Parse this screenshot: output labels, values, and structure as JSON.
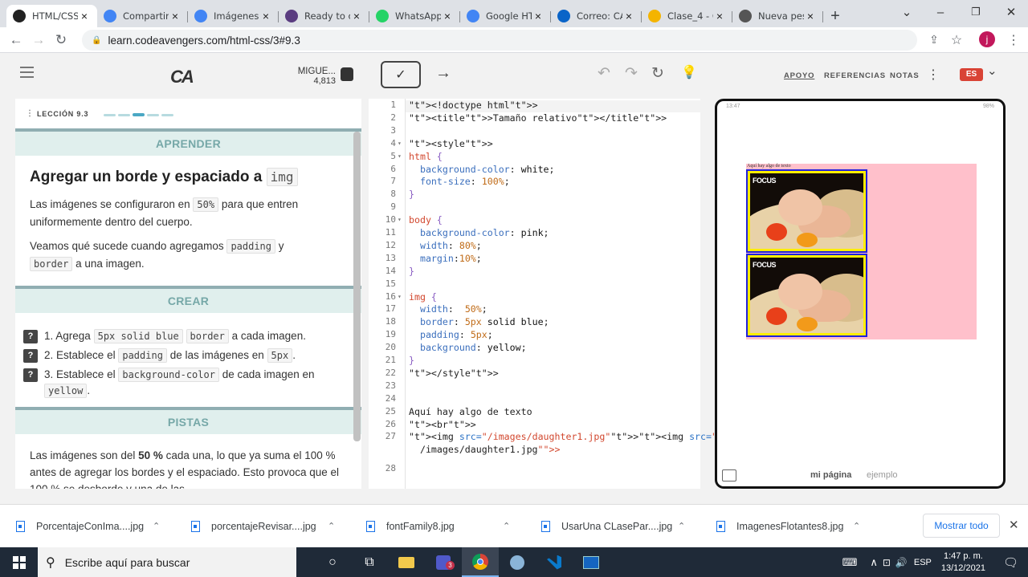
{
  "browser": {
    "tabs": [
      {
        "title": "HTML/CSS",
        "icon": "codeavengers-icon",
        "color": "#222222",
        "active": true
      },
      {
        "title": "Compartir",
        "icon": "google-icon",
        "color": "#4285f4"
      },
      {
        "title": "Imágenes",
        "icon": "google-icon",
        "color": "#4285f4"
      },
      {
        "title": "Ready to c",
        "icon": "ready-icon",
        "color": "#5a3c80"
      },
      {
        "title": "WhatsApp",
        "icon": "whatsapp-icon",
        "color": "#25d366"
      },
      {
        "title": "Google HT",
        "icon": "google-icon",
        "color": "#4285f4"
      },
      {
        "title": "Correo: CA",
        "icon": "outlook-icon",
        "color": "#0a64c8"
      },
      {
        "title": "Clase_4 - C",
        "icon": "drive-icon",
        "color": "#f4b400"
      },
      {
        "title": "Nueva pes",
        "icon": "chrome-icon",
        "color": "#555555"
      }
    ],
    "url": "learn.codeavengers.com/html-css/3#9.3",
    "profile_initial": "j"
  },
  "app": {
    "logo": "CA",
    "user_name": "MIGUE...",
    "user_points": "4,813",
    "header_links": [
      "APOYO",
      "REFERENCIAS",
      "NOTAS"
    ],
    "language": "ES"
  },
  "lesson": {
    "label": "LECCIÓN 9.3",
    "learn_header": "APRENDER",
    "title_text": "Agregar un borde y espaciado a",
    "title_code": "img",
    "p1_a": "Las imágenes se configuraron en",
    "p1_code": "50%",
    "p1_b": "para que entren uniformemente dentro del cuerpo.",
    "p2_a": "Veamos qué sucede cuando agregamos",
    "p2_code1": "padding",
    "p2_b": "y",
    "p2_code2": "border",
    "p2_c": "a una imagen.",
    "create_header": "CREAR",
    "tasks": [
      {
        "num": "1.",
        "a": "Agrega",
        "code1": "5px solid blue",
        "code2": "border",
        "b": "a cada imagen."
      },
      {
        "num": "2.",
        "a": "Establece el",
        "code1": "padding",
        "b": "de las imágenes en",
        "code2": "5px",
        "c": "."
      },
      {
        "num": "3.",
        "a": "Establece el",
        "code1": "background-color",
        "b": "de cada imagen en",
        "code2": "yellow",
        "c": "."
      }
    ],
    "hints_header": "PISTAS",
    "hint_a": "Las imágenes son del",
    "hint_bold": "50 %",
    "hint_b": "cada una, lo que ya suma el 100 % antes de agregar los bordes y el espaciado. Esto",
    "hint_c": "provoca que el 100 % se desborde y una de las"
  },
  "editor": {
    "lines": [
      {
        "n": "1",
        "code": "<!doctype html>"
      },
      {
        "n": "2",
        "code": "<title>Tamaño relativo</title>"
      },
      {
        "n": "3",
        "code": ""
      },
      {
        "n": "4",
        "code": "<style>",
        "fold": true
      },
      {
        "n": "5",
        "code": "html {",
        "fold": true
      },
      {
        "n": "6",
        "code": "  background-color: white;"
      },
      {
        "n": "7",
        "code": "  font-size: 100%;"
      },
      {
        "n": "8",
        "code": "}"
      },
      {
        "n": "9",
        "code": ""
      },
      {
        "n": "10",
        "code": "body {",
        "fold": true
      },
      {
        "n": "11",
        "code": "  background-color: pink;"
      },
      {
        "n": "12",
        "code": "  width: 80%;"
      },
      {
        "n": "13",
        "code": "  margin:10%;"
      },
      {
        "n": "14",
        "code": "}"
      },
      {
        "n": "15",
        "code": ""
      },
      {
        "n": "16",
        "code": "img {",
        "fold": true
      },
      {
        "n": "17",
        "code": "  width:  50%;"
      },
      {
        "n": "18",
        "code": "  border: 5px solid blue;"
      },
      {
        "n": "19",
        "code": "  padding: 5px;"
      },
      {
        "n": "20",
        "code": "  background: yellow;"
      },
      {
        "n": "21",
        "code": "}"
      },
      {
        "n": "22",
        "code": "</style>"
      },
      {
        "n": "23",
        "code": ""
      },
      {
        "n": "24",
        "code": ""
      },
      {
        "n": "25",
        "code": "Aquí hay algo de texto"
      },
      {
        "n": "26",
        "code": "<br>"
      },
      {
        "n": "27",
        "code": "<img src=\"/images/daughter1.jpg\"><img src=\""
      },
      {
        "n": "",
        "code": "  /images/daughter1.jpg\">"
      },
      {
        "n": "28",
        "code": ""
      }
    ]
  },
  "preview": {
    "time": "13:47",
    "battery": "98%",
    "page_text": "Aquí hay algo de texto",
    "image_logo": "FOCUS",
    "tab_mine": "mi página",
    "tab_example": "ejemplo"
  },
  "downloads": {
    "files": [
      "PorcentajeConIma....jpg",
      "porcentajeRevisar....jpg",
      "fontFamily8.jpg",
      "UsarUna CLasePar....jpg",
      "ImagenesFlotantes8.jpg"
    ],
    "show_all": "Mostrar todo"
  },
  "taskbar": {
    "search_placeholder": "Escribe aquí para buscar",
    "lang": "ESP",
    "time": "1:47 p. m.",
    "date": "13/12/2021",
    "teams_badge": "3"
  }
}
